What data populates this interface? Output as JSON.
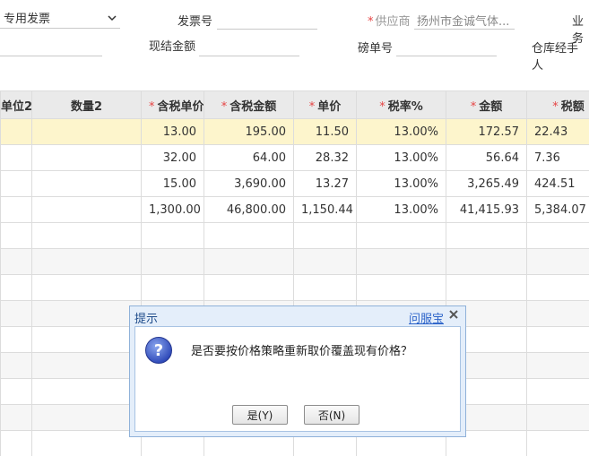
{
  "form": {
    "invoice_type": "专用发票",
    "invoice_no_label": "发票号",
    "supplier_label": "供应商",
    "supplier_value": "扬州市金诚气体...",
    "business_label_partial": "业务",
    "cash_amount_label": "现结金额",
    "weigh_no_label": "磅单号",
    "warehouse_handler_label": "仓库经手人"
  },
  "grid": {
    "headers": [
      {
        "label": "单位2",
        "required": false
      },
      {
        "label": "数量2",
        "required": false
      },
      {
        "label": "含税单价",
        "required": true
      },
      {
        "label": "含税金额",
        "required": true
      },
      {
        "label": "单价",
        "required": true
      },
      {
        "label": "税率%",
        "required": true
      },
      {
        "label": "金额",
        "required": true
      },
      {
        "label": "税额",
        "required": true
      }
    ],
    "rows": [
      [
        "",
        "",
        "13.00",
        "195.00",
        "11.50",
        "13.00%",
        "172.57",
        "22.43"
      ],
      [
        "",
        "",
        "32.00",
        "64.00",
        "28.32",
        "13.00%",
        "56.64",
        "7.36"
      ],
      [
        "",
        "",
        "15.00",
        "3,690.00",
        "13.27",
        "13.00%",
        "3,265.49",
        "424.51"
      ],
      [
        "",
        "",
        "1,300.00",
        "46,800.00",
        "1,150.44",
        "13.00%",
        "41,415.93",
        "5,384.07"
      ]
    ],
    "empty_rows": 9
  },
  "dialog": {
    "title": "提示",
    "help_link": "问服宝",
    "message": "是否要按价格策略重新取价覆盖现有价格？",
    "yes_label": "是(Y)",
    "no_label": "否(N)"
  }
}
